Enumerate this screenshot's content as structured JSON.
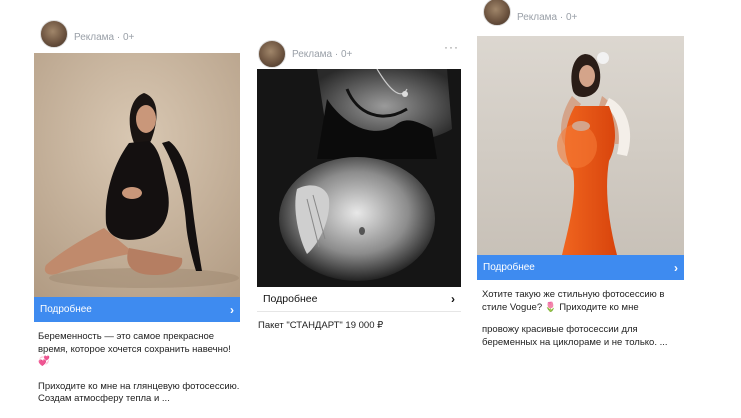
{
  "cards": [
    {
      "meta": "Реклама · 0+",
      "cta_label": "Подробнее",
      "text_p1": "Беременность — это самое прекрасное время, которое хочется сохранить навечно! 💞",
      "text_p2": "Приходите ко мне на глянцевую фотосессию. Создам атмосферу тепла и ...",
      "photo_icon": "pregnant-woman-black-bodysuit-photo"
    },
    {
      "meta": "Реклама · 0+",
      "more_label": "···",
      "cta_label": "Подробнее",
      "text": "Пакет \"СТАНДАРТ\" 19 000 ₽",
      "photo_icon": "pregnant-belly-black-white-photo"
    },
    {
      "meta": "Реклама · 0+",
      "cta_label": "Подробнее",
      "text_p1": "Хотите такую же стильную фотосессию в стиле Vogue? 🌷 Приходите ко мне",
      "text_p2": "провожу красивые фотосессии для беременных на циклораме и не только. ...",
      "photo_icon": "pregnant-woman-orange-dress-photo"
    }
  ],
  "colors": {
    "cta_blue": "#3e8bf0",
    "meta_gray": "#9aa0a8"
  }
}
